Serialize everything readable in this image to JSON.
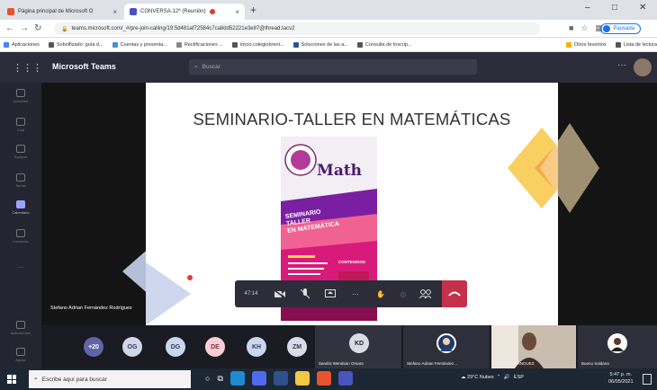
{
  "browser": {
    "tabs": [
      {
        "label": "Página principal de Microsoft O",
        "favicon_color": "#e8542e",
        "recording": false
      },
      {
        "label": "CONVERSA-12ª (Reunión)",
        "favicon_color": "#4b53bc",
        "recording": true
      }
    ],
    "url": "teams.microsoft.com/_#/pre-join-calling/19:5d481af72584c7ca8dd52221e3e87@thread.tacv2",
    "profile_label": "Pausada",
    "bookmarks": [
      {
        "label": "Aplicaciones",
        "color": "#4285f4"
      },
      {
        "label": "Sobolfizado: guía d...",
        "color": "#555555"
      },
      {
        "label": "Cuentas y presenta...",
        "color": "#4a90d9"
      },
      {
        "label": "Rectificaciones ...",
        "color": "#888888"
      },
      {
        "label": "inicio.colegiobrent...",
        "color": "#555555"
      },
      {
        "label": "Soluciones de las a...",
        "color": "#2b5797"
      },
      {
        "label": "Consulta de Inscrip...",
        "color": "#555555"
      },
      {
        "label": "Otros favoritos",
        "color": "#f4b400"
      },
      {
        "label": "Lista de lectura",
        "color": "#555555"
      }
    ]
  },
  "teams": {
    "title": "Microsoft Teams",
    "search_placeholder": "Buscar",
    "rail": [
      {
        "label": "Actividad",
        "active": false
      },
      {
        "label": "Chat",
        "active": false
      },
      {
        "label": "Equipos",
        "active": false
      },
      {
        "label": "Tareas",
        "active": false
      },
      {
        "label": "Calendario",
        "active": true
      },
      {
        "label": "Llamadas",
        "active": false
      },
      {
        "label": "...",
        "active": false
      }
    ],
    "rail_bottom": [
      {
        "label": "Aplicaciones"
      },
      {
        "label": "Ayuda"
      }
    ]
  },
  "meeting": {
    "slide_title": "SEMINARIO-TALLER EN MATEMÁTICAS",
    "poster": {
      "math": "Math",
      "line1": "SEMINARIO",
      "line2": "TALLER",
      "line3": "EN MATEMÁTICA",
      "side_label": "CONTENIDOS"
    },
    "presenter": "Stefano Adrian Fernández Rodríguez",
    "timer": "47:14",
    "participants": [
      {
        "initials": "+20",
        "color": "#6264a7",
        "text_color": "#ffffff"
      },
      {
        "initials": "OG",
        "color": "#cfd6ea",
        "text_color": "#3a3a5a"
      },
      {
        "initials": "DG",
        "color": "#c9d7ef",
        "text_color": "#3a3a5a"
      },
      {
        "initials": "DE",
        "color": "#f6cfd5",
        "text_color": "#8b2d3d"
      },
      {
        "initials": "KH",
        "color": "#c9d7ef",
        "text_color": "#3a3a5a"
      },
      {
        "initials": "ZM",
        "color": "#d9dce6",
        "text_color": "#3a3a5a"
      }
    ],
    "tiles": [
      {
        "name": "Sandra Wendsan Omara",
        "initials": "KD"
      },
      {
        "name": "Stefano Adrian Fernández...",
        "initials": ""
      },
      {
        "name": "LAURA DOMINGUEZ",
        "initials": ""
      },
      {
        "name": "Bueno Saldana",
        "initials": ""
      }
    ]
  },
  "taskbar": {
    "search_placeholder": "Escribe aquí para buscar",
    "weather": "29°C Nubes",
    "language": "ESP",
    "time": "5:47 p. m.",
    "date": "06/05/2021"
  }
}
